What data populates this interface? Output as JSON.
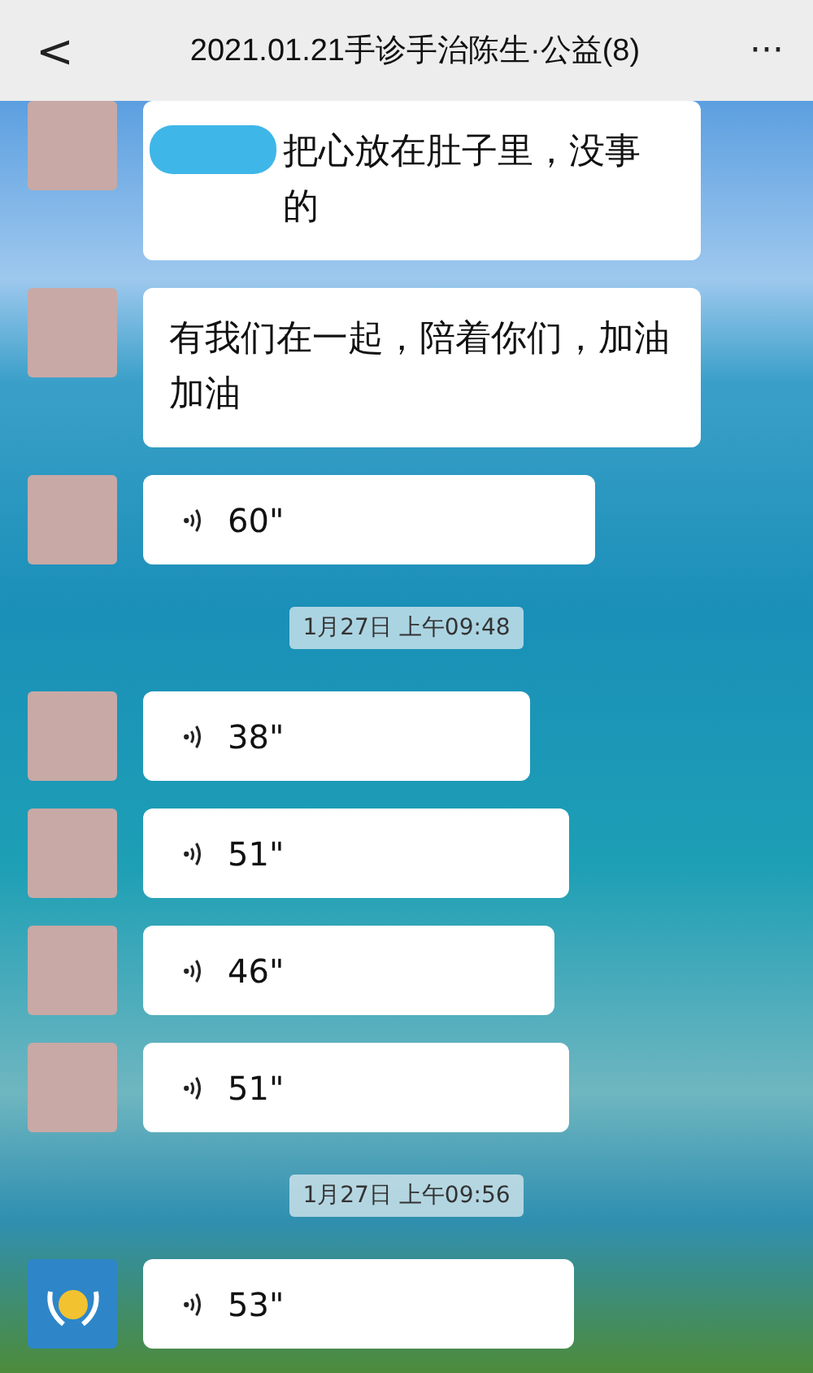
{
  "header": {
    "back": "<",
    "title": "2021.01.21手诊手治陈生·公益(8)",
    "more": "···"
  },
  "messages": [
    {
      "kind": "text",
      "avatar": {
        "kind": "photo"
      },
      "text": "把心放在肚子里，没事的",
      "redacted": true
    },
    {
      "kind": "text",
      "avatar": {
        "kind": "photo"
      },
      "text": "有我们在一起，陪着你们，加油加油",
      "redacted": false
    },
    {
      "kind": "voice",
      "avatar": {
        "kind": "photo"
      },
      "duration": "60\""
    },
    {
      "kind": "time",
      "text": "1月27日 上午09:48"
    },
    {
      "kind": "voice",
      "avatar": {
        "kind": "photo"
      },
      "duration": "38\""
    },
    {
      "kind": "voice",
      "avatar": {
        "kind": "photo"
      },
      "duration": "51\""
    },
    {
      "kind": "voice",
      "avatar": {
        "kind": "photo"
      },
      "duration": "46\""
    },
    {
      "kind": "voice",
      "avatar": {
        "kind": "photo"
      },
      "duration": "51\""
    },
    {
      "kind": "time",
      "text": "1月27日 上午09:56"
    },
    {
      "kind": "voice",
      "avatar": {
        "kind": "logo"
      },
      "duration": "53\""
    }
  ]
}
